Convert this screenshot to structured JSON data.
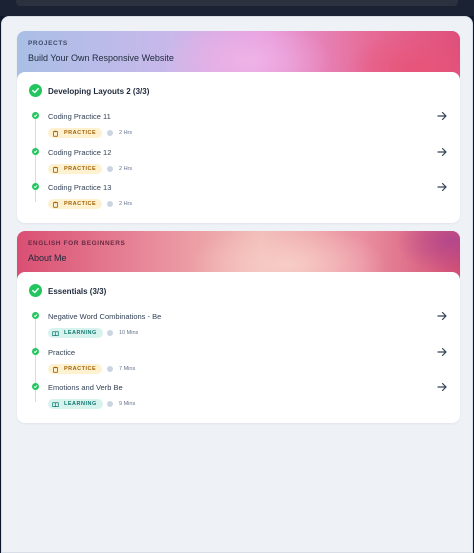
{
  "cards": [
    {
      "eyebrow": "PROJECTS",
      "title": "Build Your Own Responsive Website",
      "section": {
        "title": "Developing Layouts 2 (3/3)"
      },
      "items": [
        {
          "title": "Coding Practice 11",
          "badge": "PRACTICE",
          "badge_type": "practice",
          "duration": "2 Hrs"
        },
        {
          "title": "Coding Practice 12",
          "badge": "PRACTICE",
          "badge_type": "practice",
          "duration": "2 Hrs"
        },
        {
          "title": "Coding Practice 13",
          "badge": "PRACTICE",
          "badge_type": "practice",
          "duration": "2 Hrs"
        }
      ]
    },
    {
      "eyebrow": "ENGLISH FOR BEGINNERS",
      "title": "About Me",
      "section": {
        "title": "Essentials (3/3)"
      },
      "items": [
        {
          "title": "Negative Word Combinations - Be",
          "badge": "LEARNING",
          "badge_type": "learning",
          "duration": "10 Mins"
        },
        {
          "title": "Practice",
          "badge": "PRACTICE",
          "badge_type": "practice",
          "duration": "7 Mins"
        },
        {
          "title": "Emotions and Verb Be",
          "badge": "LEARNING",
          "badge_type": "learning",
          "duration": "9 Mins"
        }
      ]
    }
  ],
  "icons": {
    "section_status": "check-circle-icon",
    "item_status": "check-dot-icon",
    "practice_badge": "clipboard-icon",
    "learning_badge": "book-icon",
    "duration": "clock-icon",
    "open": "arrow-right-icon"
  },
  "colors": {
    "success": "#22c55e",
    "practice_bg": "#fdf1cf",
    "practice_text": "#a16207",
    "learning_bg": "#d7f3ee",
    "learning_text": "#0f766e"
  }
}
